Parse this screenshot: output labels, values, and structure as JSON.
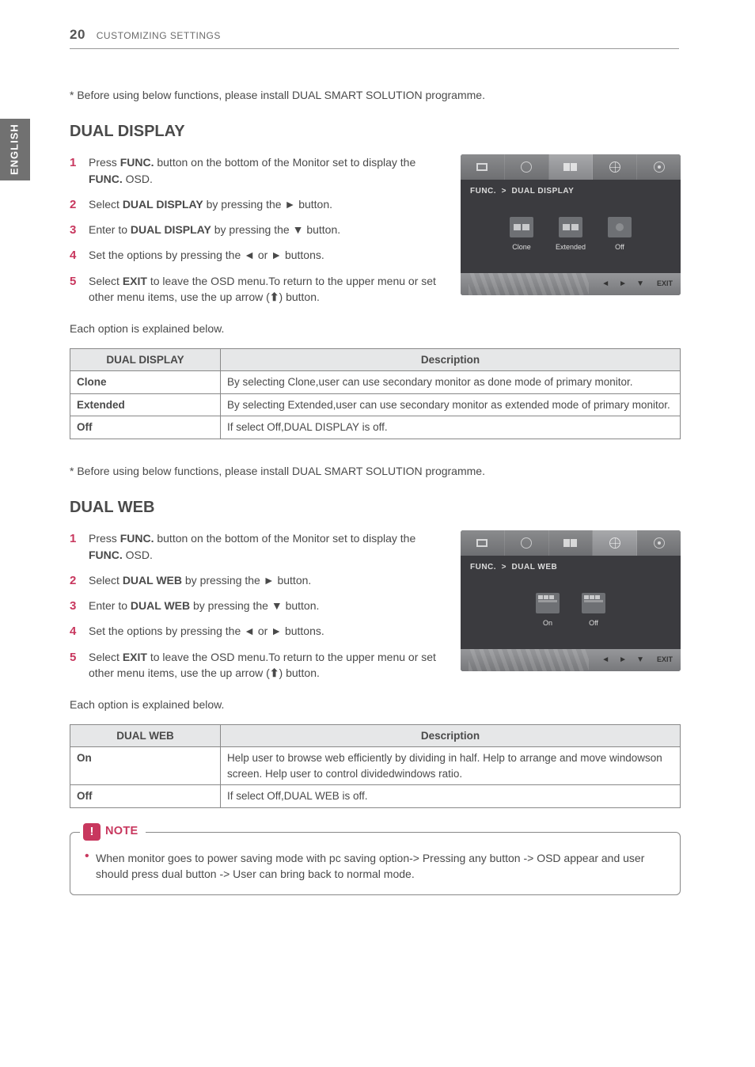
{
  "colors": {
    "accent": "#c8375e"
  },
  "sidebar": {
    "language": "ENGLISH"
  },
  "header": {
    "page_number": "20",
    "section": "CUSTOMIZING SETTINGS"
  },
  "intro_note": "* Before using below functions, please install DUAL SMART SOLUTION programme.",
  "sections": {
    "dual_display": {
      "title": "DUAL DISPLAY",
      "steps": [
        {
          "n": "1",
          "pre": "Press ",
          "b": "FUNC.",
          "mid": " button on the bottom of the Monitor set to display the ",
          "b2": "FUNC.",
          "post": " OSD."
        },
        {
          "n": "2",
          "pre": "Select ",
          "b": "DUAL DISPLAY",
          "mid": " by pressing the ► button.",
          "b2": "",
          "post": ""
        },
        {
          "n": "3",
          "pre": "Enter to ",
          "b": "DUAL DISPLAY",
          "mid": " by pressing the ▼ button.",
          "b2": "",
          "post": ""
        },
        {
          "n": "4",
          "pre": "Set the options by pressing the ◄ or ► buttons.",
          "b": "",
          "mid": "",
          "b2": "",
          "post": ""
        },
        {
          "n": "5",
          "pre": "Select ",
          "b": "EXIT",
          "mid": " to leave the OSD menu.To return to the upper menu or set other menu items, use the up arrow (",
          "b2": "",
          "post": ") button.",
          "has_arrow": true
        }
      ],
      "osd": {
        "breadcrumb_a": "FUNC.",
        "breadcrumb_sep": ">",
        "breadcrumb_b": "DUAL DISPLAY",
        "options": [
          "Clone",
          "Extended",
          "Off"
        ],
        "exit": "EXIT"
      },
      "table_intro": "Each option is explained below.",
      "table": {
        "col1": "DUAL DISPLAY",
        "col2": "Description",
        "rows": [
          {
            "opt": "Clone",
            "desc": "By selecting Clone,user can use secondary monitor as done mode of primary monitor."
          },
          {
            "opt": "Extended",
            "desc": "By selecting Extended,user can use secondary monitor as extended mode of primary monitor."
          },
          {
            "opt": "Off",
            "desc": "If select Off,DUAL DISPLAY is off."
          }
        ]
      }
    },
    "dual_web": {
      "title": "DUAL WEB",
      "steps": [
        {
          "n": "1",
          "pre": "Press ",
          "b": "FUNC.",
          "mid": " button on the bottom of the Monitor set to display the ",
          "b2": "FUNC.",
          "post": " OSD."
        },
        {
          "n": "2",
          "pre": "Select ",
          "b": "DUAL WEB",
          "mid": " by pressing the ► button.",
          "b2": "",
          "post": ""
        },
        {
          "n": "3",
          "pre": "Enter to ",
          "b": "DUAL WEB",
          "mid": " by pressing the ▼ button.",
          "b2": "",
          "post": ""
        },
        {
          "n": "4",
          "pre": "Set the options by pressing the ◄ or ► buttons.",
          "b": "",
          "mid": "",
          "b2": "",
          "post": ""
        },
        {
          "n": "5",
          "pre": "Select ",
          "b": "EXIT",
          "mid": " to leave the OSD menu.To return to the upper menu or set other menu items, use the up arrow (",
          "b2": "",
          "post": ") button.",
          "has_arrow": true
        }
      ],
      "osd": {
        "breadcrumb_a": "FUNC.",
        "breadcrumb_sep": ">",
        "breadcrumb_b": "DUAL WEB",
        "options": [
          "On",
          "Off"
        ],
        "exit": "EXIT"
      },
      "table_intro": "Each option is explained below.",
      "table": {
        "col1": "DUAL WEB",
        "col2": "Description",
        "rows": [
          {
            "opt": "On",
            "desc": "Help user to browse web efficiently by dividing in half. Help to arrange and move windowson screen. Help user to control dividedwindows ratio."
          },
          {
            "opt": "Off",
            "desc": "If select Off,DUAL WEB is off."
          }
        ]
      }
    }
  },
  "note": {
    "label": "NOTE",
    "text": "When monitor goes to power saving mode with pc saving option-> Pressing any button -> OSD appear and user should press dual button -> User can bring back to normal mode."
  }
}
